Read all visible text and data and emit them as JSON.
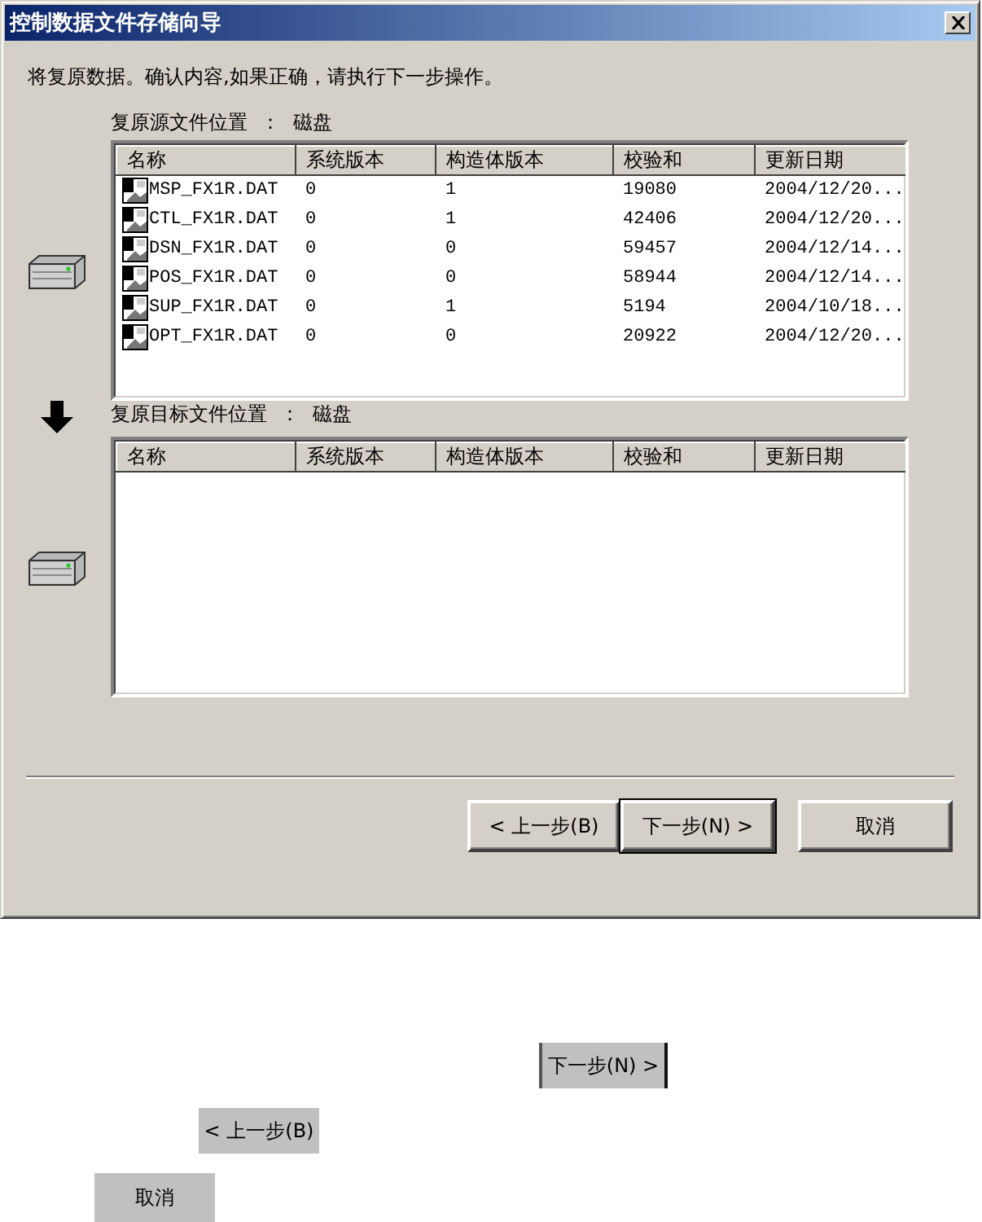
{
  "window": {
    "title": "控制数据文件存储向导"
  },
  "instruction": "将复原数据。确认内容,如果正确，请执行下一步操作。",
  "source": {
    "label": "复原源文件位置",
    "separator": "：",
    "value": "磁盘",
    "columns": [
      "名称",
      "系统版本",
      "构造体版本",
      "校验和",
      "更新日期"
    ],
    "rows": [
      [
        "MSP_FX1R.DAT",
        "0",
        "1",
        "19080",
        "2004/12/20..."
      ],
      [
        "CTL_FX1R.DAT",
        "0",
        "1",
        "42406",
        "2004/12/20..."
      ],
      [
        "DSN_FX1R.DAT",
        "0",
        "0",
        "59457",
        "2004/12/14..."
      ],
      [
        "POS_FX1R.DAT",
        "0",
        "0",
        "58944",
        "2004/12/14..."
      ],
      [
        "SUP_FX1R.DAT",
        "0",
        "1",
        "5194",
        "2004/10/18..."
      ],
      [
        "OPT_FX1R.DAT",
        "0",
        "0",
        "20922",
        "2004/12/20..."
      ]
    ]
  },
  "target": {
    "label": "复原目标文件位置",
    "separator": "：",
    "value": "磁盘",
    "columns": [
      "名称",
      "系统版本",
      "构造体版本",
      "校验和",
      "更新日期"
    ]
  },
  "buttons": [
    {
      "kind": "back",
      "label": "上一步(B)",
      "arrow": "<",
      "default": false
    },
    {
      "kind": "next",
      "label": "下一步(N)",
      "arrow": ">",
      "default": true
    },
    {
      "kind": "cancel",
      "label": "取消",
      "default": false
    }
  ],
  "loose_buttons": [
    {
      "kind": "next",
      "label": "下一步(N)",
      "arrow": ">"
    },
    {
      "kind": "back",
      "label": "上一步(B)",
      "arrow": "<"
    },
    {
      "kind": "cancel",
      "label": "取消"
    }
  ]
}
